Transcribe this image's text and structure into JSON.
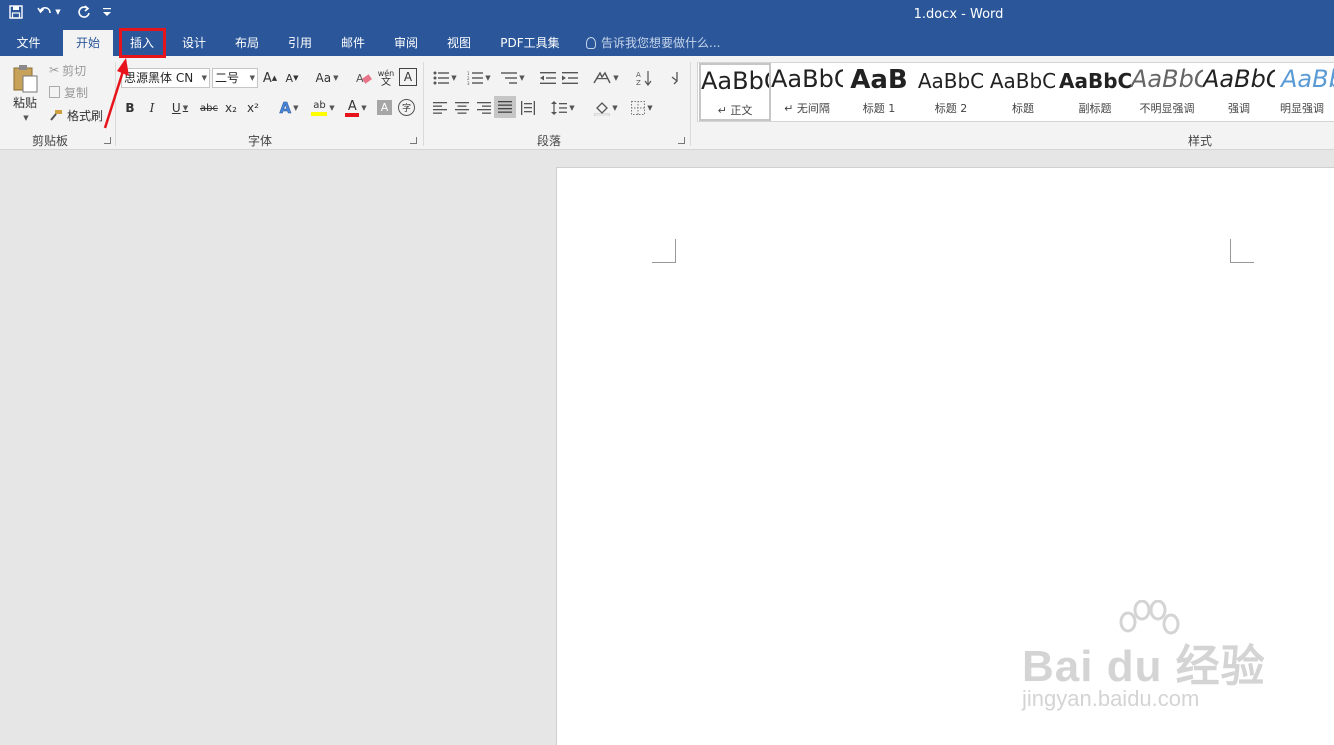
{
  "app": {
    "document_title": "1.docx - Word"
  },
  "quick_access": {
    "save_icon": "save-icon",
    "undo_icon": "undo-icon",
    "redo_icon": "redo-icon",
    "customize_icon": "customize-qat-icon"
  },
  "tabs": [
    {
      "label": "文件"
    },
    {
      "label": "开始"
    },
    {
      "label": "插入"
    },
    {
      "label": "设计"
    },
    {
      "label": "布局"
    },
    {
      "label": "引用"
    },
    {
      "label": "邮件"
    },
    {
      "label": "审阅"
    },
    {
      "label": "视图"
    },
    {
      "label": "PDF工具集"
    }
  ],
  "tell_me": {
    "placeholder": "告诉我您想要做什么..."
  },
  "clipboard": {
    "group_label": "剪贴板",
    "paste": "粘贴",
    "cut": "剪切",
    "copy": "复制",
    "format_painter": "格式刷"
  },
  "font": {
    "group_label": "字体",
    "font_name": "思源黑体 CN",
    "font_size": "二号",
    "bold": "B",
    "italic": "I",
    "underline": "U",
    "strikethrough": "abc",
    "subscript": "x₂",
    "superscript": "x²",
    "change_case": "Aa",
    "phonetic": "wén\n文",
    "enclose_char": "字",
    "char_border": "A",
    "font_color": "A",
    "grow": "A",
    "shrink": "A"
  },
  "paragraph": {
    "group_label": "段落"
  },
  "styles": {
    "group_label": "样式",
    "items": [
      {
        "sample": "AaBbCcDd",
        "name": "↵ 正文"
      },
      {
        "sample": "AaBbCcDd",
        "name": "↵ 无间隔"
      },
      {
        "sample": "AaB",
        "name": "标题 1"
      },
      {
        "sample": "AaBbC",
        "name": "标题 2"
      },
      {
        "sample": "AaBbC",
        "name": "标题"
      },
      {
        "sample": "AaBbC",
        "name": "副标题"
      },
      {
        "sample": "AaBbCcDd",
        "name": "不明显强调"
      },
      {
        "sample": "AaBbCcDd",
        "name": "强调"
      },
      {
        "sample": "AaBbCcDd",
        "name": "明显强调"
      }
    ]
  },
  "watermark": {
    "main": "Bai du 经验",
    "sub": "jingyan.baidu.com"
  },
  "colors": {
    "ribbon_blue": "#2b579a",
    "annotation_red": "#e8141c"
  }
}
